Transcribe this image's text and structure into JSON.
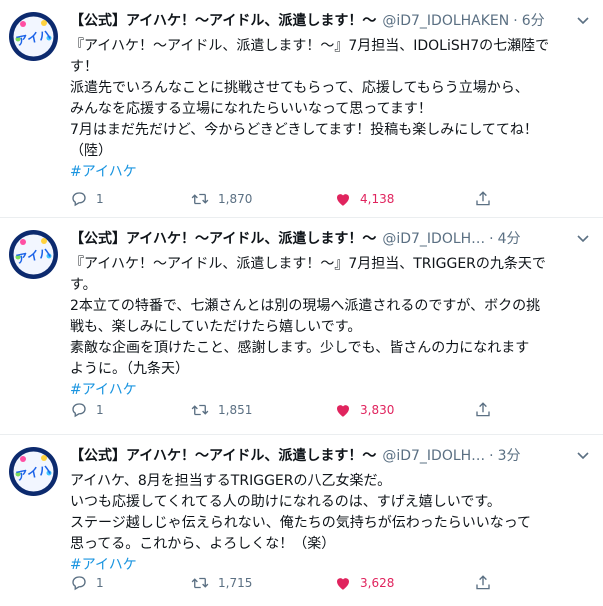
{
  "tweets": [
    {
      "name": "【公式】アイハケ！〜アイドル、派遣します！〜",
      "handle": "@iD7_IDOLHAKEN",
      "time": "6分",
      "lines": [
        "『アイハケ！〜アイドル、派遣します！〜』7月担当、IDOLiSH7の七瀬陸で",
        "す！",
        "派遣先でいろんなことに挑戦させてもらって、応援してもらう立場から、",
        "みんなを応援する立場になれたらいいなって思ってます！",
        "7月はまだ先だけど、今からどきどきしてます！投稿も楽しみにしててね！",
        "（陸）"
      ],
      "hashtag": "#アイハケ",
      "replies": "1",
      "retweets": "1,870",
      "likes": "4,138"
    },
    {
      "name": "【公式】アイハケ！〜アイドル、派遣します！〜",
      "handle": "@iD7_IDOLH…",
      "time": "4分",
      "lines": [
        "『アイハケ！〜アイドル、派遣します！〜』7月担当、TRIGGERの九条天で",
        "す。",
        "2本立ての特番で、七瀬さんとは別の現場へ派遣されるのですが、ボクの挑",
        "戦も、楽しみにしていただけたら嬉しいです。",
        "素敵な企画を頂けたこと、感謝します。少しでも、皆さんの力になれます",
        "ように。（九条天）"
      ],
      "hashtag": "#アイハケ",
      "replies": "1",
      "retweets": "1,851",
      "likes": "3,830"
    },
    {
      "name": "【公式】アイハケ！〜アイドル、派遣します！〜",
      "handle": "@iD7_IDOLH…",
      "time": "3分",
      "lines": [
        "アイハケ、8月を担当するTRIGGERの八乙女楽だ。",
        "いつも応援してくれてる人の助けになれるのは、すげえ嬉しいです。",
        "ステージ越しじゃ伝えられない、俺たちの気持ちが伝わったらいいなって",
        "思ってる。これから、よろしくな！（楽）"
      ],
      "hashtag": "#アイハケ",
      "replies": "1",
      "retweets": "1,715",
      "likes": "3,628"
    }
  ],
  "colors": {
    "text": "#0f1419",
    "muted": "#5b7083",
    "link": "#1b95e0",
    "like": "#e0245e"
  }
}
